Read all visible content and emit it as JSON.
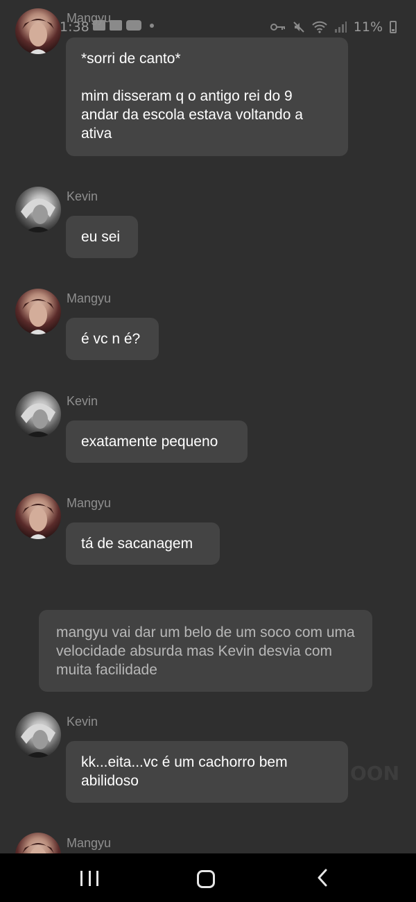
{
  "status_bar": {
    "time": "1:38",
    "battery": "11%"
  },
  "messages": [
    {
      "sender": "Mangyu",
      "avatar": "mangyu",
      "text": "*sorri de canto*\n\nmim disseram q o antigo rei do 9 andar da escola estava voltando a ativa"
    },
    {
      "sender": "Kevin",
      "avatar": "kevin",
      "text": "eu sei"
    },
    {
      "sender": "Mangyu",
      "avatar": "mangyu",
      "text": "é vc n é?"
    },
    {
      "sender": "Kevin",
      "avatar": "kevin",
      "text": "exatamente pequeno"
    },
    {
      "sender": "Mangyu",
      "avatar": "mangyu",
      "text": "tá de sacanagem"
    },
    {
      "sender": "Kevin",
      "avatar": "kevin",
      "text": "kk...eita...vc é um cachorro bem abilidoso"
    },
    {
      "sender": "Mangyu",
      "avatar": "mangyu",
      "text": ""
    }
  ],
  "narration": "mangyu vai dar um belo de um soco com uma velocidade absurda mas Kevin desvia com muita facilidade",
  "watermark": "OON",
  "nav": {
    "recent": "recent-apps-icon",
    "home": "home-icon",
    "back": "back-icon"
  }
}
